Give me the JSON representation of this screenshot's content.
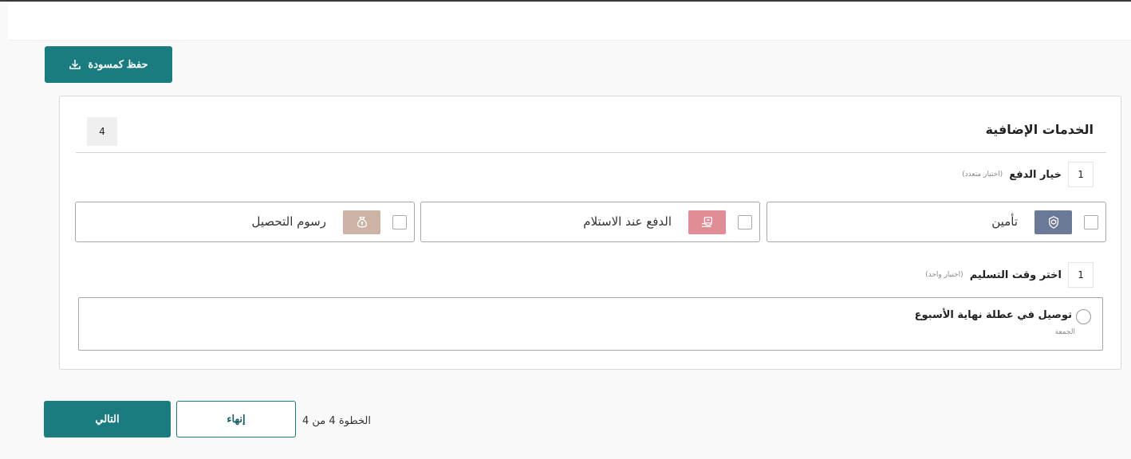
{
  "toolbar": {
    "save_draft_label": "حفظ كمسودة"
  },
  "card": {
    "title": "الخدمات الإضافية",
    "count": "4"
  },
  "payment_section": {
    "number": "1",
    "title": "خيار الدفع",
    "hint": "(اختيار متعدد)",
    "options": [
      {
        "label": "تأمين",
        "icon": "shield-box-icon",
        "icon_bg": "#6b7896",
        "checked": false
      },
      {
        "label": "الدفع عند الاستلام",
        "icon": "cash-on-delivery-icon",
        "icon_bg": "#e08d96",
        "checked": false
      },
      {
        "label": "رسوم التحصيل",
        "icon": "money-bag-icon",
        "icon_bg": "#cdb3a6",
        "checked": false
      }
    ]
  },
  "delivery_section": {
    "number": "1",
    "title": "اختر وقت التسليم",
    "hint": "(اختيار واحد)",
    "option_title": "توصيل في عطلة نهاية الأسبوع",
    "option_sub": "الجمعة",
    "selected": false
  },
  "footer": {
    "next_label": "التالي",
    "finish_label": "إنهاء",
    "step_text": "الخطوة 4 من 4"
  },
  "colors": {
    "primary": "#1a7c7f",
    "border": "#a8a8a8"
  }
}
